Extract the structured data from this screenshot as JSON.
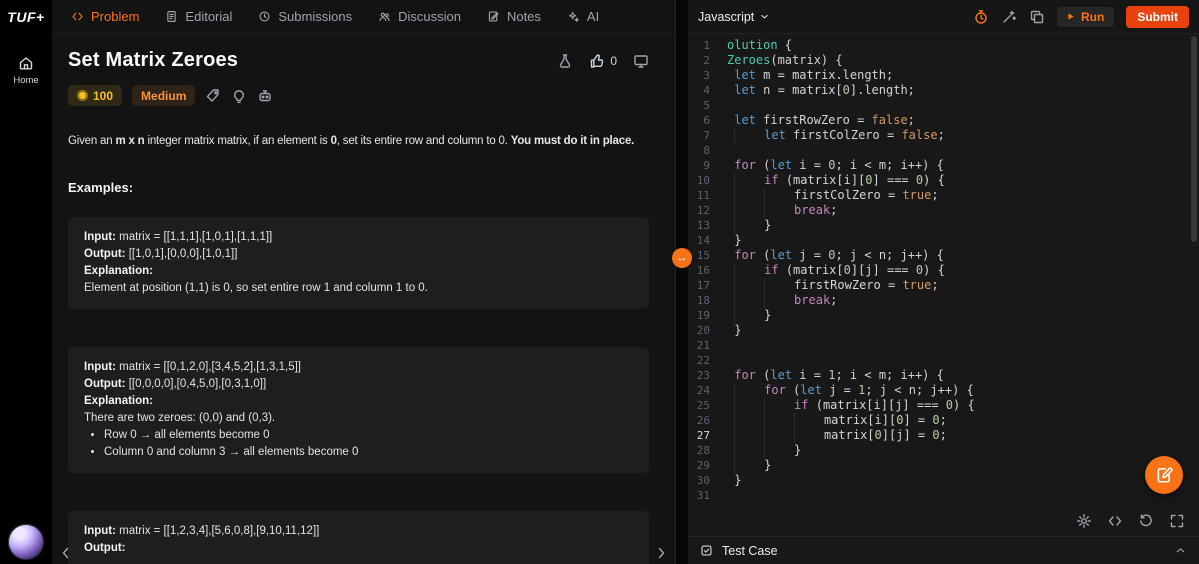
{
  "colors": {
    "accent": "#f97316",
    "submit": "#e8430e",
    "difficulty": "#fb923c",
    "points": "#fbbf24"
  },
  "rail": {
    "logo": "TUF+",
    "home": "Home"
  },
  "tabs": [
    {
      "label": "Problem",
      "active": true
    },
    {
      "label": "Editorial",
      "active": false
    },
    {
      "label": "Submissions",
      "active": false
    },
    {
      "label": "Discussion",
      "active": false
    },
    {
      "label": "Notes",
      "active": false
    },
    {
      "label": "AI",
      "active": false
    }
  ],
  "problem": {
    "title": "Set Matrix Zeroes",
    "likes": "0",
    "points": "100",
    "difficulty": "Medium",
    "statement": [
      {
        "text": "Given an ",
        "bold": false
      },
      {
        "text": "m x n",
        "bold": true
      },
      {
        "text": " integer matrix matrix, if an element is ",
        "bold": false
      },
      {
        "text": "0",
        "bold": true
      },
      {
        "text": ", set its entire row and column to 0. ",
        "bold": false
      },
      {
        "text": "You must do it in place.",
        "bold": true
      }
    ],
    "examples_heading": "Examples:",
    "labels": {
      "input": "Input:",
      "output": "Output:",
      "explanation": "Explanation:"
    },
    "examples": [
      {
        "input": "matrix = [[1,1,1],[1,0,1],[1,1,1]]",
        "output": "[[1,0,1],[0,0,0],[1,0,1]]",
        "explanation": [
          "Element at position (1,1) is 0, so set entire row 1 and column 1 to 0."
        ],
        "bullets": []
      },
      {
        "input": "matrix = [[0,1,2,0],[3,4,5,2],[1,3,1,5]]",
        "output": "[[0,0,0,0],[0,4,5,0],[0,3,1,0]]",
        "explanation": [
          "There are two zeroes: (0,0) and (0,3)."
        ],
        "bullets": [
          "Row 0 → all elements become 0",
          "Column 0 and column 3 → all elements become 0"
        ]
      },
      {
        "input": "matrix = [[1,2,3,4],[5,6,0,8],[9,10,11,12]]",
        "output": "",
        "explanation": [],
        "bullets": []
      }
    ]
  },
  "editor": {
    "language": "Javascript",
    "run": "Run",
    "submit": "Submit",
    "active_line": 27,
    "lines": [
      {
        "indent": 0,
        "tokens": [
          [
            "type",
            "olution"
          ],
          [
            "pl",
            " {"
          ]
        ]
      },
      {
        "indent": 0,
        "tokens": [
          [
            "type",
            "Zeroes"
          ],
          [
            "pl",
            "(matrix) {"
          ]
        ]
      },
      {
        "indent": 1,
        "tokens": [
          [
            "kw",
            "let"
          ],
          [
            "pl",
            " m "
          ],
          [
            "op",
            "="
          ],
          [
            "pl",
            " matrix.length;"
          ]
        ]
      },
      {
        "indent": 1,
        "tokens": [
          [
            "kw",
            "let"
          ],
          [
            "pl",
            " n "
          ],
          [
            "op",
            "="
          ],
          [
            "pl",
            " matrix["
          ],
          [
            "num",
            "0"
          ],
          [
            "pl",
            "].length;"
          ]
        ]
      },
      {
        "indent": 0,
        "tokens": []
      },
      {
        "indent": 1,
        "tokens": [
          [
            "kw",
            "let"
          ],
          [
            "pl",
            " firstRowZero "
          ],
          [
            "op",
            "="
          ],
          [
            "pl",
            " "
          ],
          [
            "bool",
            "false"
          ],
          [
            "pl",
            ";"
          ]
        ]
      },
      {
        "indent": 5,
        "tokens": [
          [
            "kw",
            "let"
          ],
          [
            "pl",
            " firstColZero "
          ],
          [
            "op",
            "="
          ],
          [
            "pl",
            " "
          ],
          [
            "bool",
            "false"
          ],
          [
            "pl",
            ";"
          ]
        ]
      },
      {
        "indent": 0,
        "tokens": []
      },
      {
        "indent": 1,
        "tokens": [
          [
            "ctrl",
            "for"
          ],
          [
            "pl",
            " ("
          ],
          [
            "kw",
            "let"
          ],
          [
            "pl",
            " i "
          ],
          [
            "op",
            "="
          ],
          [
            "pl",
            " "
          ],
          [
            "num",
            "0"
          ],
          [
            "pl",
            "; i "
          ],
          [
            "op",
            "<"
          ],
          [
            "pl",
            " m; i"
          ],
          [
            "op",
            "++"
          ],
          [
            "pl",
            ") {"
          ]
        ]
      },
      {
        "indent": 5,
        "tokens": [
          [
            "ctrl",
            "if"
          ],
          [
            "pl",
            " (matrix[i]["
          ],
          [
            "num",
            "0"
          ],
          [
            "pl",
            "] "
          ],
          [
            "op",
            "==="
          ],
          [
            "pl",
            " "
          ],
          [
            "num",
            "0"
          ],
          [
            "pl",
            ") {"
          ]
        ]
      },
      {
        "indent": 9,
        "tokens": [
          [
            "pl",
            "firstColZero "
          ],
          [
            "op",
            "="
          ],
          [
            "pl",
            " "
          ],
          [
            "bool",
            "true"
          ],
          [
            "pl",
            ";"
          ]
        ]
      },
      {
        "indent": 9,
        "tokens": [
          [
            "ctrl",
            "break"
          ],
          [
            "pl",
            ";"
          ]
        ]
      },
      {
        "indent": 5,
        "tokens": [
          [
            "pl",
            "}"
          ]
        ]
      },
      {
        "indent": 1,
        "tokens": [
          [
            "pl",
            "}"
          ]
        ]
      },
      {
        "indent": 1,
        "tokens": [
          [
            "ctrl",
            "for"
          ],
          [
            "pl",
            " ("
          ],
          [
            "kw",
            "let"
          ],
          [
            "pl",
            " j "
          ],
          [
            "op",
            "="
          ],
          [
            "pl",
            " "
          ],
          [
            "num",
            "0"
          ],
          [
            "pl",
            "; j "
          ],
          [
            "op",
            "<"
          ],
          [
            "pl",
            " n; j"
          ],
          [
            "op",
            "++"
          ],
          [
            "pl",
            ") {"
          ]
        ]
      },
      {
        "indent": 5,
        "tokens": [
          [
            "ctrl",
            "if"
          ],
          [
            "pl",
            " (matrix["
          ],
          [
            "num",
            "0"
          ],
          [
            "pl",
            "][j] "
          ],
          [
            "op",
            "==="
          ],
          [
            "pl",
            " "
          ],
          [
            "num",
            "0"
          ],
          [
            "pl",
            ") {"
          ]
        ]
      },
      {
        "indent": 9,
        "tokens": [
          [
            "pl",
            "firstRowZero "
          ],
          [
            "op",
            "="
          ],
          [
            "pl",
            " "
          ],
          [
            "bool",
            "true"
          ],
          [
            "pl",
            ";"
          ]
        ]
      },
      {
        "indent": 9,
        "tokens": [
          [
            "ctrl",
            "break"
          ],
          [
            "pl",
            ";"
          ]
        ]
      },
      {
        "indent": 5,
        "tokens": [
          [
            "pl",
            "}"
          ]
        ]
      },
      {
        "indent": 1,
        "tokens": [
          [
            "pl",
            "}"
          ]
        ]
      },
      {
        "indent": 0,
        "tokens": []
      },
      {
        "indent": 0,
        "tokens": []
      },
      {
        "indent": 1,
        "tokens": [
          [
            "ctrl",
            "for"
          ],
          [
            "pl",
            " ("
          ],
          [
            "kw",
            "let"
          ],
          [
            "pl",
            " i "
          ],
          [
            "op",
            "="
          ],
          [
            "pl",
            " "
          ],
          [
            "num",
            "1"
          ],
          [
            "pl",
            "; i "
          ],
          [
            "op",
            "<"
          ],
          [
            "pl",
            " m; i"
          ],
          [
            "op",
            "++"
          ],
          [
            "pl",
            ") {"
          ]
        ]
      },
      {
        "indent": 5,
        "tokens": [
          [
            "ctrl",
            "for"
          ],
          [
            "pl",
            " ("
          ],
          [
            "kw",
            "let"
          ],
          [
            "pl",
            " j "
          ],
          [
            "op",
            "="
          ],
          [
            "pl",
            " "
          ],
          [
            "num",
            "1"
          ],
          [
            "pl",
            "; j "
          ],
          [
            "op",
            "<"
          ],
          [
            "pl",
            " n; j"
          ],
          [
            "op",
            "++"
          ],
          [
            "pl",
            ") {"
          ]
        ]
      },
      {
        "indent": 9,
        "tokens": [
          [
            "ctrl",
            "if"
          ],
          [
            "pl",
            " (matrix[i][j] "
          ],
          [
            "op",
            "==="
          ],
          [
            "pl",
            " "
          ],
          [
            "num",
            "0"
          ],
          [
            "pl",
            ") {"
          ]
        ]
      },
      {
        "indent": 13,
        "tokens": [
          [
            "pl",
            "matrix[i]["
          ],
          [
            "num",
            "0"
          ],
          [
            "pl",
            "] "
          ],
          [
            "op",
            "="
          ],
          [
            "pl",
            " "
          ],
          [
            "num",
            "0"
          ],
          [
            "pl",
            ";"
          ]
        ]
      },
      {
        "indent": 13,
        "tokens": [
          [
            "pl",
            "matrix["
          ],
          [
            "num",
            "0"
          ],
          [
            "pl",
            "][j] "
          ],
          [
            "op",
            "="
          ],
          [
            "pl",
            " "
          ],
          [
            "num",
            "0"
          ],
          [
            "pl",
            ";"
          ]
        ]
      },
      {
        "indent": 9,
        "tokens": [
          [
            "pl",
            "}"
          ]
        ]
      },
      {
        "indent": 5,
        "tokens": [
          [
            "pl",
            "}"
          ]
        ]
      },
      {
        "indent": 1,
        "tokens": [
          [
            "pl",
            "}"
          ]
        ]
      },
      {
        "indent": 0,
        "tokens": []
      }
    ]
  },
  "testcase": {
    "label": "Test Case"
  }
}
